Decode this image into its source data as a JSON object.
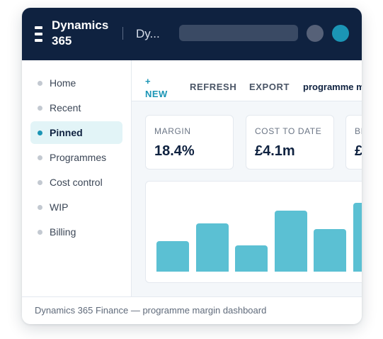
{
  "header": {
    "app_name": "Dynamics 365",
    "breadcrumb": "Dy...",
    "search_placeholder": "",
    "colors": {
      "topbar": "#0f2240",
      "accent": "#1b95b5"
    }
  },
  "sidebar": {
    "items": [
      {
        "label": "Home",
        "active": false
      },
      {
        "label": "Recent",
        "active": false
      },
      {
        "label": "Pinned",
        "active": true
      },
      {
        "label": "Programmes",
        "active": false
      },
      {
        "label": "Cost control",
        "active": false
      },
      {
        "label": "WIP",
        "active": false
      },
      {
        "label": "Billing",
        "active": false
      }
    ]
  },
  "commandbar": {
    "new_label": "+ NEW",
    "refresh_label": "REFRESH",
    "export_label": "EXPORT",
    "view_label": "programme margin"
  },
  "kpis": [
    {
      "label": "MARGIN",
      "value": "18.4%"
    },
    {
      "label": "COST TO DATE",
      "value": "£4.1m"
    },
    {
      "label": "BI",
      "value": "£"
    }
  ],
  "chart_data": {
    "type": "bar",
    "values": [
      43,
      68,
      37,
      86,
      60,
      97
    ],
    "ylim": [
      0,
      100
    ],
    "color": "#5bc0d3"
  },
  "footer": {
    "text": "Dynamics 365 Finance — programme margin dashboard"
  }
}
